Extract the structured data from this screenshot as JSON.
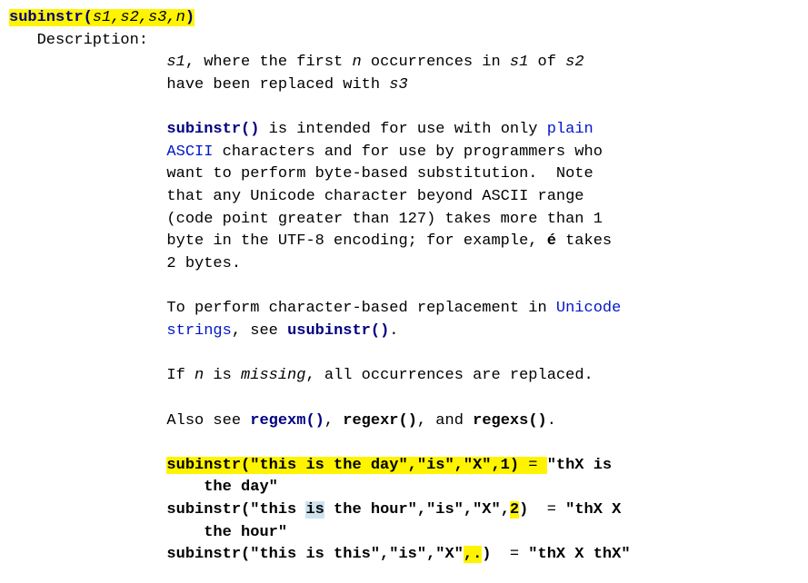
{
  "sig": {
    "fn": "subinstr",
    "open": "(",
    "args": "s1,s2,s3,n",
    "close": ")"
  },
  "labels": {
    "description": "Description:  "
  },
  "desc": {
    "p1a": "s1",
    "p1b": ", where the first ",
    "p1c": "n",
    "p1d": " occurrences in ",
    "p1e": "s1",
    "p1f": " of ",
    "p1g": "s2",
    "p1h": "have been replaced with ",
    "p1i": "s3",
    "p2a": "subinstr()",
    "p2b": " is intended for use with only ",
    "p2c": "plain",
    "p2d": "ASCII",
    "p2e": " characters and for use by programmers who",
    "p2f": "want to perform byte-based substitution.  Note",
    "p2g": "that any Unicode character beyond ASCII range",
    "p2h": "(code point greater than 127) takes more than 1",
    "p2i": "byte in the UTF-8 encoding; for example, ",
    "p2j": "é",
    "p2k": " takes",
    "p2l": "2 bytes.",
    "p3a": "To perform character-based replacement in ",
    "p3b": "Unicode",
    "p3c": "strings",
    "p3d": ", see ",
    "p3e": "usubinstr()",
    "p3f": ".",
    "p4a": "If ",
    "p4b": "n",
    "p4c": " is ",
    "p4d": "missing",
    "p4e": ", all occurrences are replaced.",
    "p5a": "Also see ",
    "p5b": "regexm()",
    "p5c": ", ",
    "p5d": "regexr()",
    "p5e": ", and ",
    "p5f": "regexs()",
    "p5g": ".",
    "ex1a": "subinstr(\"this is the day\",\"is\",\"X\",1)",
    "ex1b": " = ",
    "ex1c": "\"thX is",
    "ex1d": "    the day\"",
    "ex2a": "subinstr(\"this ",
    "ex2b": "is",
    "ex2c": " the hour\",\"is\",\"X\",",
    "ex2d": "2",
    "ex2e": ")",
    "ex2f": "  = ",
    "ex2g": "\"thX X",
    "ex2h": "    the hour\"",
    "ex3a": "subinstr(\"this is this\",\"is\",\"X\"",
    "ex3b": ",.",
    "ex3c": ")",
    "ex3d": "  = ",
    "ex3e": "\"thX X thX\""
  }
}
